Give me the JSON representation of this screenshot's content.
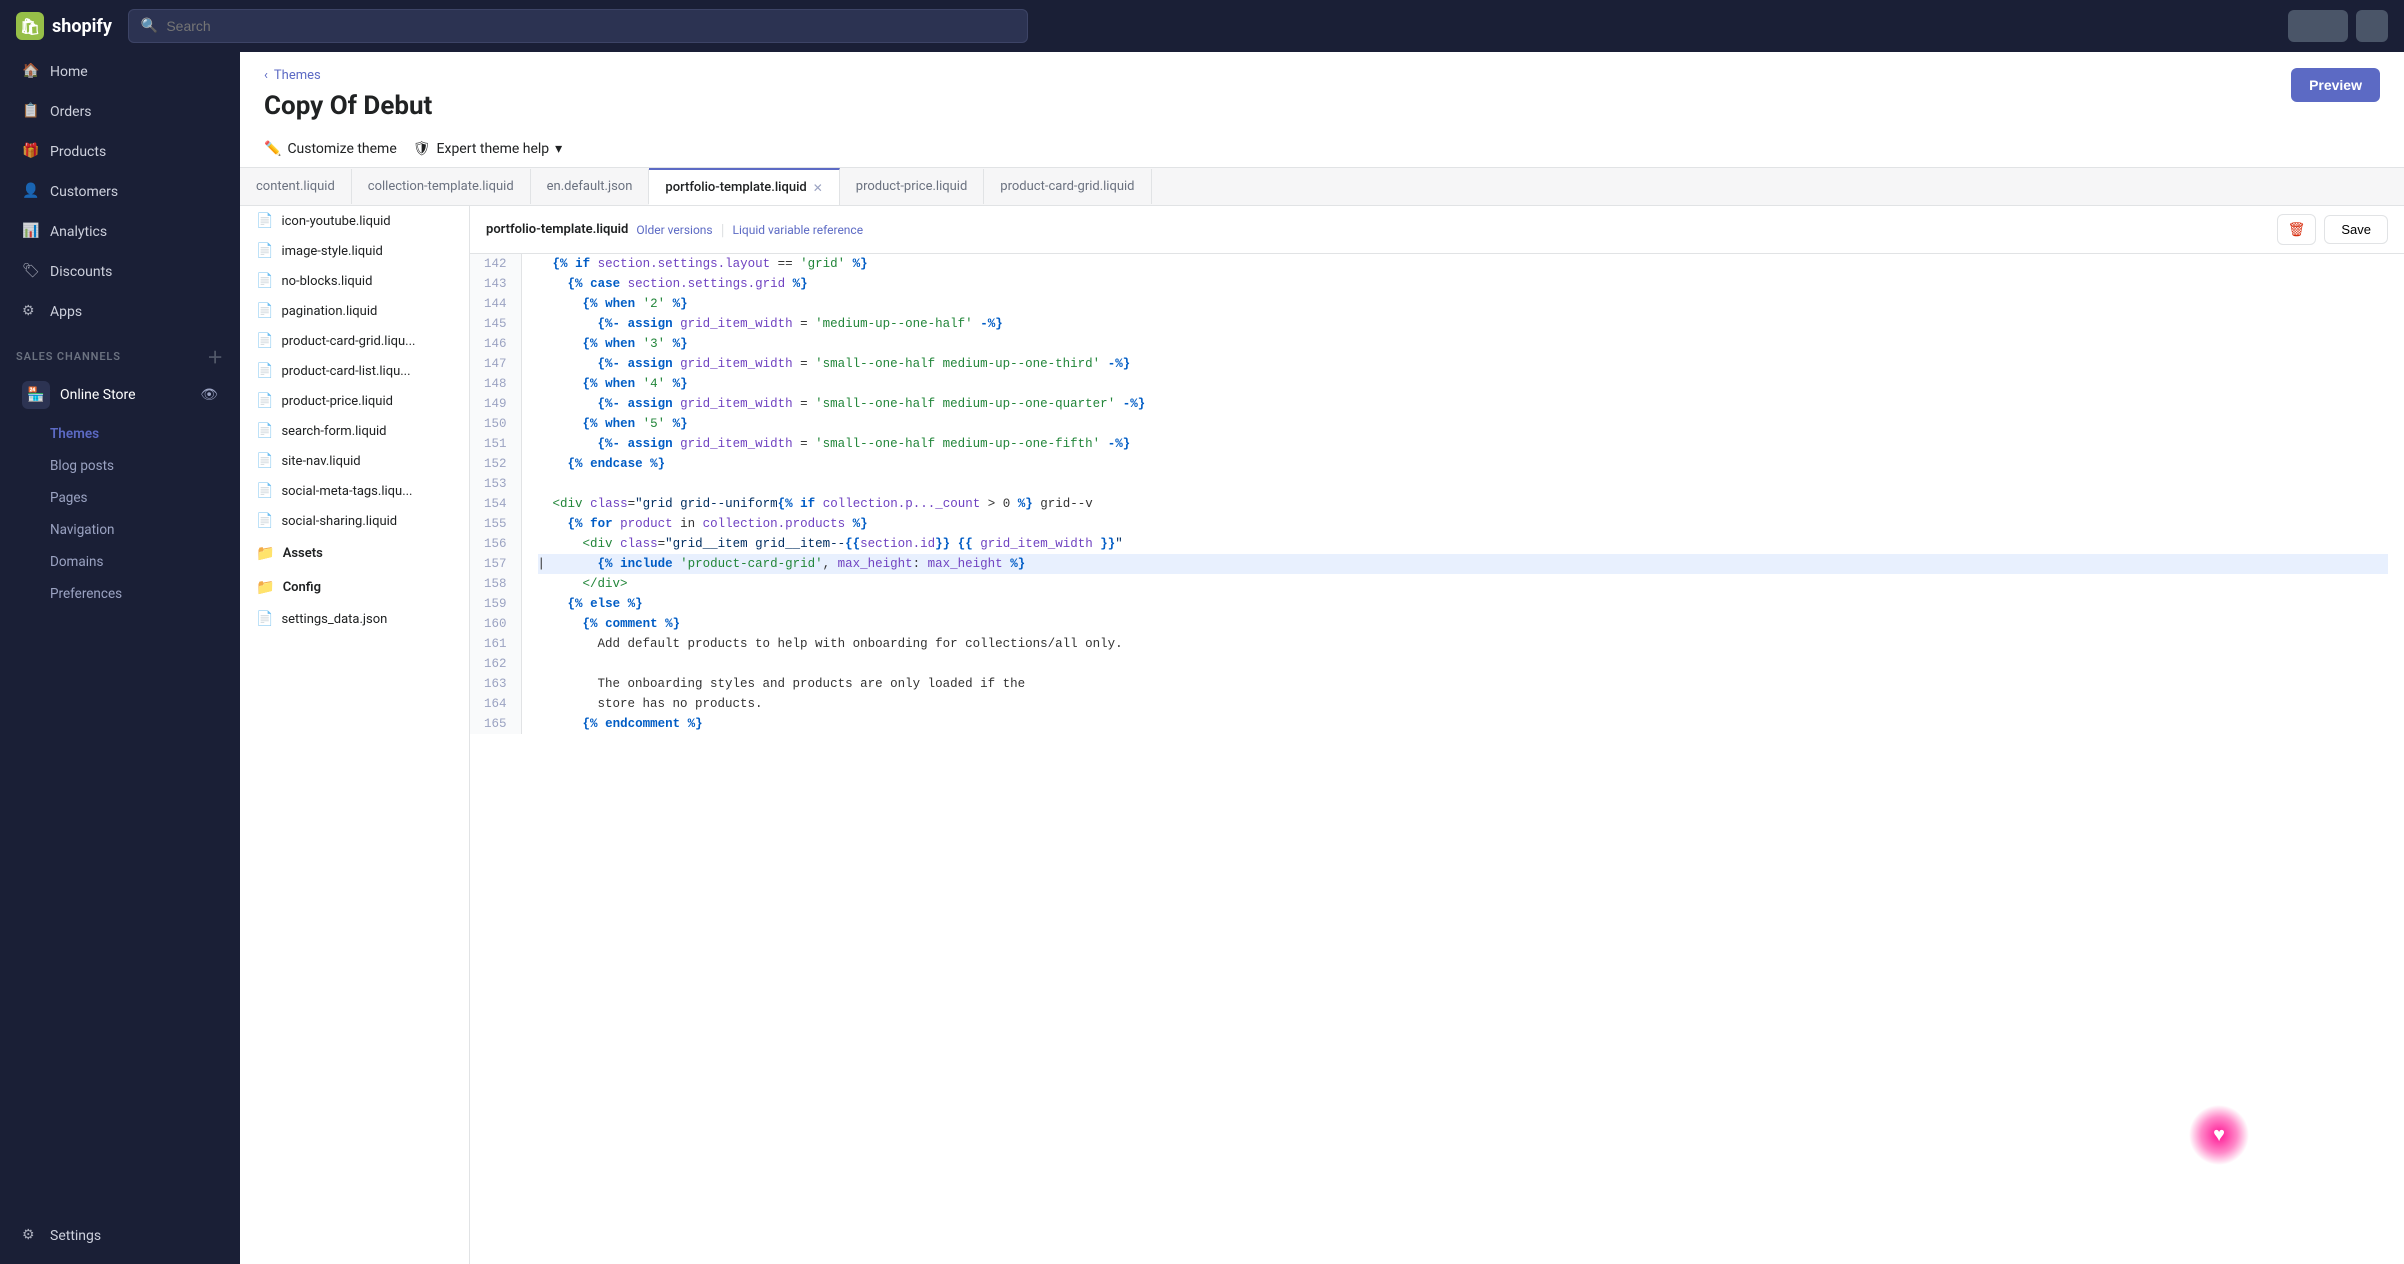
{
  "topnav": {
    "logo_text": "shopify",
    "search_placeholder": "Search"
  },
  "sidebar": {
    "nav_items": [
      {
        "id": "home",
        "label": "Home",
        "icon": "🏠"
      },
      {
        "id": "orders",
        "label": "Orders",
        "icon": "📋"
      },
      {
        "id": "products",
        "label": "Products",
        "icon": "🎁"
      },
      {
        "id": "customers",
        "label": "Customers",
        "icon": "👤"
      },
      {
        "id": "analytics",
        "label": "Analytics",
        "icon": "📊"
      },
      {
        "id": "discounts",
        "label": "Discounts",
        "icon": "🏷"
      },
      {
        "id": "apps",
        "label": "Apps",
        "icon": "⚙"
      }
    ],
    "sales_channels_label": "SALES CHANNELS",
    "online_store_label": "Online Store",
    "sub_items": [
      {
        "id": "themes",
        "label": "Themes",
        "active": true
      },
      {
        "id": "blog-posts",
        "label": "Blog posts"
      },
      {
        "id": "pages",
        "label": "Pages"
      },
      {
        "id": "navigation",
        "label": "Navigation"
      },
      {
        "id": "domains",
        "label": "Domains"
      },
      {
        "id": "preferences",
        "label": "Preferences"
      }
    ],
    "settings_label": "Settings"
  },
  "page": {
    "breadcrumb": "Themes",
    "title": "Copy Of Debut",
    "customize_label": "Customize theme",
    "expert_help_label": "Expert theme help",
    "preview_label": "Preview"
  },
  "tabs": [
    {
      "id": "content-liquid",
      "label": "content.liquid",
      "active": false,
      "closable": false
    },
    {
      "id": "collection-template",
      "label": "collection-template.liquid",
      "active": false,
      "closable": false
    },
    {
      "id": "en-default-json",
      "label": "en.default.json",
      "active": false,
      "closable": false
    },
    {
      "id": "portfolio-template",
      "label": "portfolio-template.liquid",
      "active": true,
      "closable": true
    },
    {
      "id": "product-price-liquid",
      "label": "product-price.liquid",
      "active": false,
      "closable": false
    },
    {
      "id": "product-card-grid",
      "label": "product-card-grid.liquid",
      "active": false,
      "closable": false
    }
  ],
  "file_panel": {
    "files": [
      {
        "name": "icon-youtube.liquid"
      },
      {
        "name": "image-style.liquid"
      },
      {
        "name": "no-blocks.liquid"
      },
      {
        "name": "pagination.liquid"
      },
      {
        "name": "product-card-grid.liqu..."
      },
      {
        "name": "product-card-list.liqu..."
      },
      {
        "name": "product-price.liquid"
      },
      {
        "name": "search-form.liquid"
      },
      {
        "name": "site-nav.liquid"
      },
      {
        "name": "social-meta-tags.liqu..."
      },
      {
        "name": "social-sharing.liquid"
      }
    ],
    "folders": [
      {
        "name": "Assets"
      },
      {
        "name": "Config"
      }
    ],
    "config_files": [
      {
        "name": "settings_data.json"
      }
    ]
  },
  "code_editor": {
    "filename": "portfolio-template.liquid",
    "older_versions_label": "Older versions",
    "liquid_reference_label": "Liquid variable reference",
    "save_label": "Save",
    "lines": [
      {
        "num": 142,
        "content": "  {% if section.settings.layout == 'grid' %}"
      },
      {
        "num": 143,
        "content": "    {% case section.settings.grid %}"
      },
      {
        "num": 144,
        "content": "      {% when '2' %}"
      },
      {
        "num": 145,
        "content": "        {%- assign grid_item_width = 'medium-up--one-half' -%}"
      },
      {
        "num": 146,
        "content": "      {% when '3' %}"
      },
      {
        "num": 147,
        "content": "        {%- assign grid_item_width = 'small--one-half medium-up--one-third' -%}"
      },
      {
        "num": 148,
        "content": "      {% when '4' %}"
      },
      {
        "num": 149,
        "content": "        {%- assign grid_item_width = 'small--one-half medium-up--one-quarter' -%}"
      },
      {
        "num": 150,
        "content": "      {% when '5' %}"
      },
      {
        "num": 151,
        "content": "        {%- assign grid_item_width = 'small--one-half medium-up--one-fifth' -%}"
      },
      {
        "num": 152,
        "content": "    {% endcase %}"
      },
      {
        "num": 153,
        "content": ""
      },
      {
        "num": 154,
        "content": "  <div class=\"grid grid--uniform{% if collection.p..._count > 0 %} grid--v"
      },
      {
        "num": 155,
        "content": "    {% for product in collection.products %}"
      },
      {
        "num": 156,
        "content": "      <div class=\"grid__item grid__item--{{section.id}} {{ grid_item_width }}"
      },
      {
        "num": 157,
        "content": "        {% include 'product-card-grid', max_height: max_height %}",
        "highlighted": true
      },
      {
        "num": 158,
        "content": "      </div>"
      },
      {
        "num": 159,
        "content": "    {% else %}"
      },
      {
        "num": 160,
        "content": "      {% comment %}"
      },
      {
        "num": 161,
        "content": "        Add default products to help with onboarding for collections/all only."
      },
      {
        "num": 162,
        "content": ""
      },
      {
        "num": 163,
        "content": "        The onboarding styles and products are only loaded if the"
      },
      {
        "num": 164,
        "content": "        store has no products."
      },
      {
        "num": 165,
        "content": "      {% endcomment %}"
      }
    ]
  }
}
